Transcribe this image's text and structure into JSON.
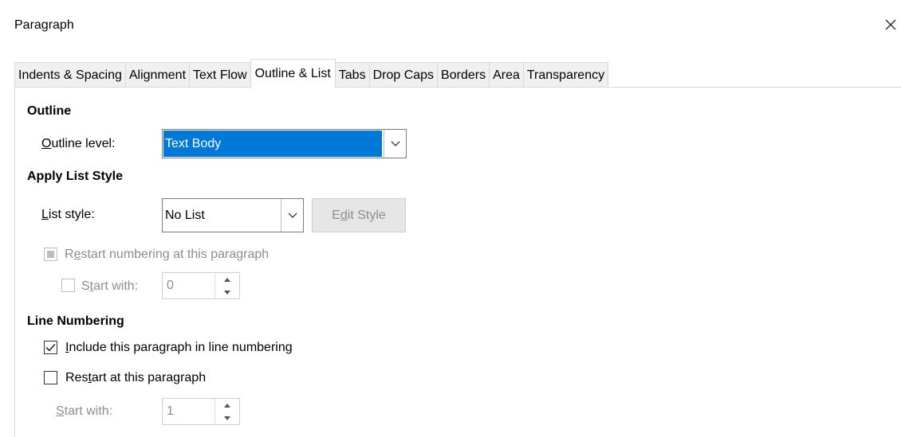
{
  "dialog": {
    "title": "Paragraph"
  },
  "tabs": [
    {
      "label": "Indents & Spacing"
    },
    {
      "label": "Alignment"
    },
    {
      "label": "Text Flow"
    },
    {
      "label": "Outline & List"
    },
    {
      "label": "Tabs"
    },
    {
      "label": "Drop Caps"
    },
    {
      "label": "Borders"
    },
    {
      "label": "Area"
    },
    {
      "label": "Transparency"
    }
  ],
  "active_tab": "Outline & List",
  "outline": {
    "title": "Outline",
    "level_label_u": "O",
    "level_label_rest": "utline level:",
    "level_value": "Text Body"
  },
  "list_style": {
    "title": "Apply List Style",
    "label_u": "L",
    "label_rest": "ist style:",
    "value": "No List",
    "edit_pre": "E",
    "edit_u": "d",
    "edit_post": "it Style",
    "restart_pre": "R",
    "restart_u": "e",
    "restart_post": "start numbering at this paragraph",
    "start_pre": "S",
    "start_u": "t",
    "start_post": "art with:",
    "start_value": "0"
  },
  "line_numbering": {
    "title": "Line Numbering",
    "include_u": "I",
    "include_rest": "nclude this paragraph in line numbering",
    "include_checked": true,
    "restart_pre": "Res",
    "restart_u": "t",
    "restart_post": "art at this paragraph",
    "restart_checked": false,
    "start_u": "S",
    "start_rest": "tart with:",
    "start_value": "1"
  },
  "colors": {
    "selection": "#0078d7",
    "disabled_text": "#8d8d8d"
  }
}
